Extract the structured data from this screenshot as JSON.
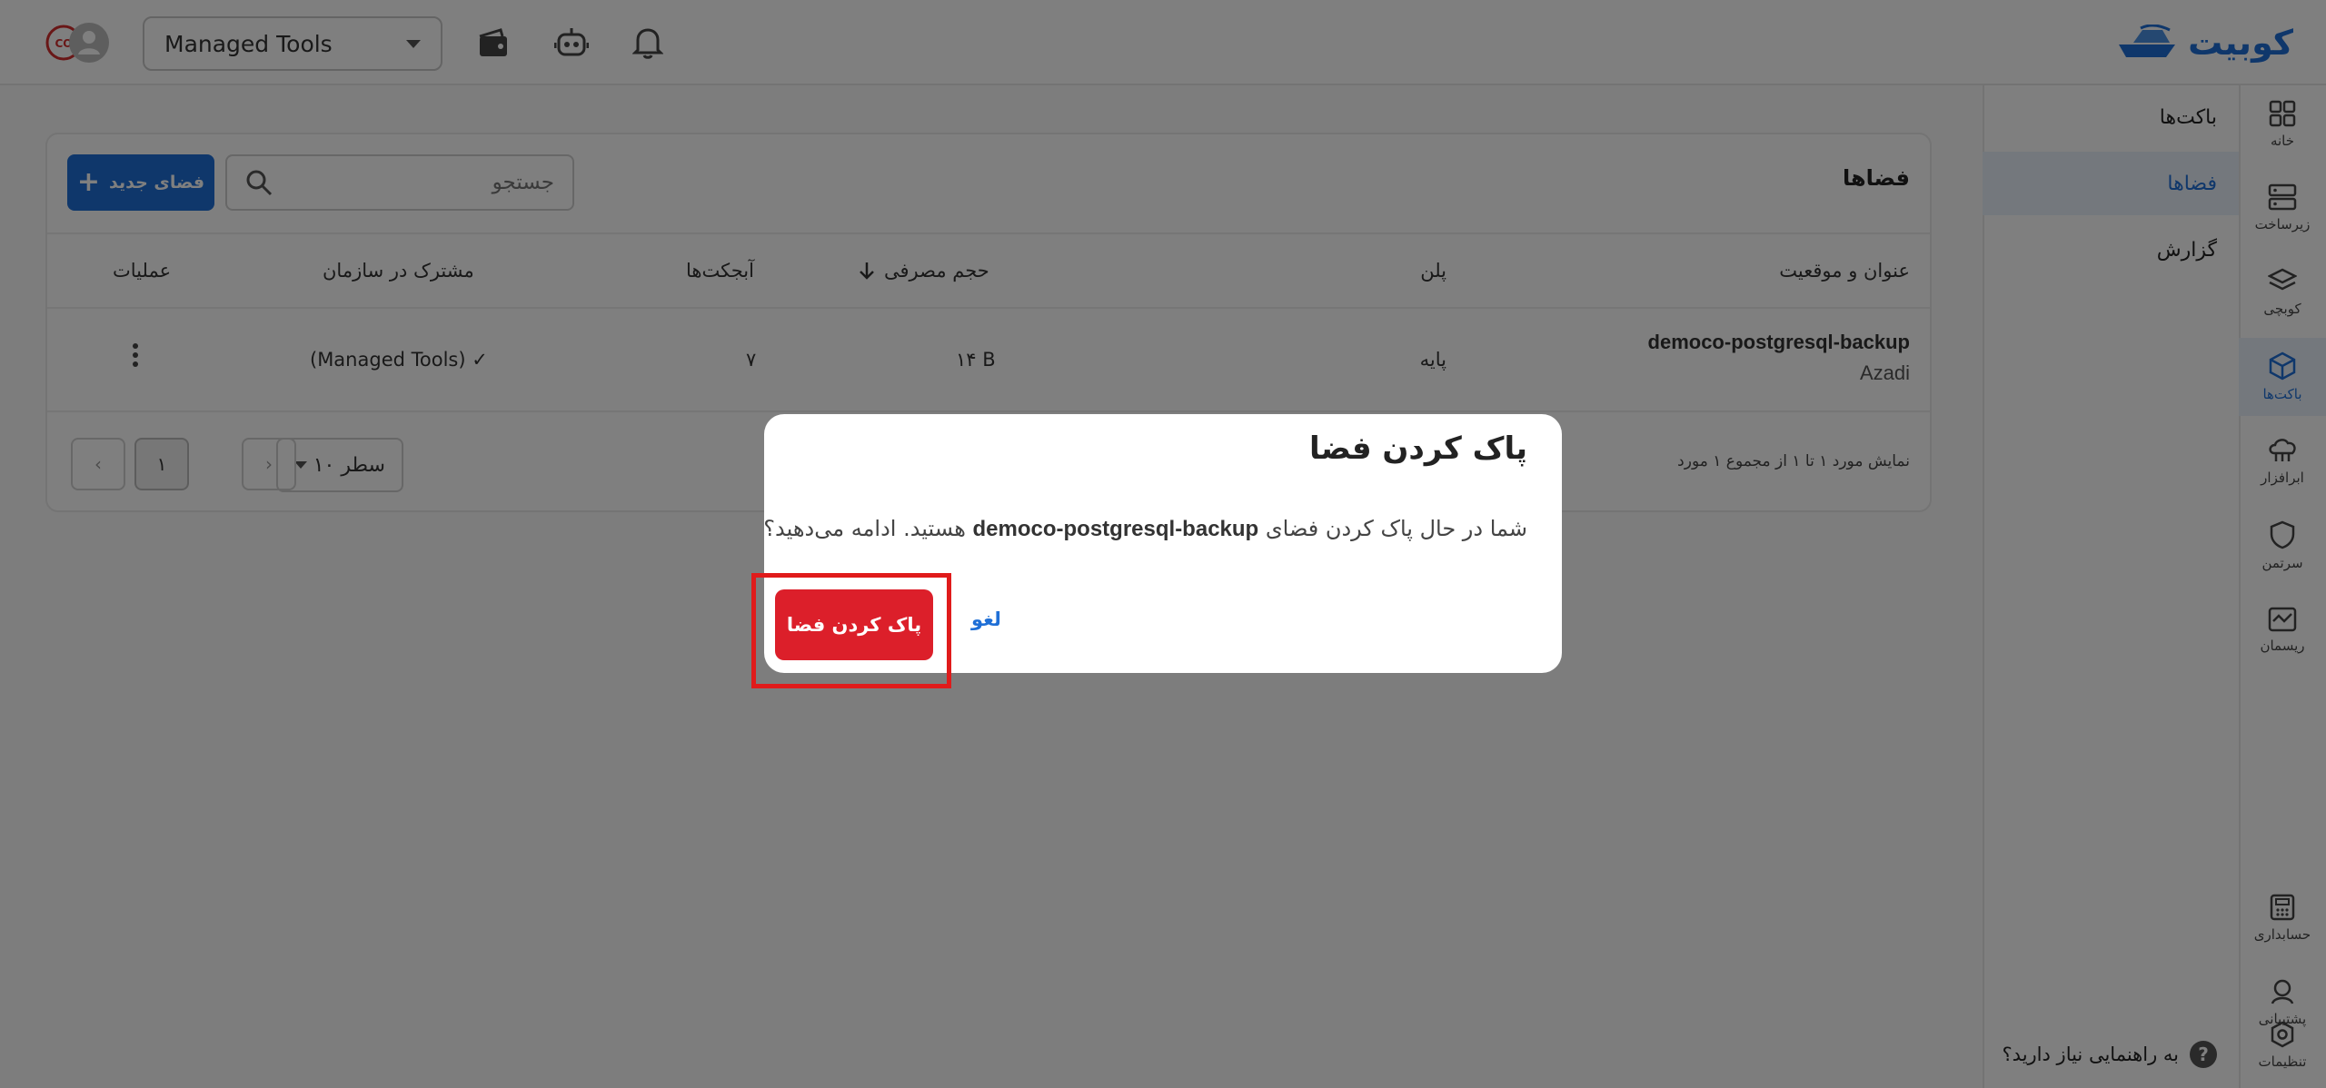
{
  "brand": {
    "name": "کوبیت",
    "color": "#1f6fd6"
  },
  "topbar": {
    "org_select_value": "Managed Tools",
    "icons": [
      "notification-bell-icon",
      "robot-icon",
      "wallet-icon",
      "user-avatar-icon"
    ]
  },
  "rail": {
    "items": [
      {
        "label": "خانه",
        "icon": "grid-icon"
      },
      {
        "label": "زیرساخت",
        "icon": "server-icon"
      },
      {
        "label": "کوبچی",
        "icon": "layers-icon"
      },
      {
        "label": "باکت‌ها",
        "icon": "cube-icon",
        "active": true
      },
      {
        "label": "ابرافزار",
        "icon": "cloud-app-icon"
      },
      {
        "label": "سرتمن",
        "icon": "shield-icon"
      },
      {
        "label": "ریسمان",
        "icon": "network-icon"
      }
    ],
    "bottom_items": [
      {
        "label": "حسابداری",
        "icon": "calculator-icon"
      },
      {
        "label": "پشتیبانی",
        "icon": "support-icon"
      },
      {
        "label": "تنظیمات",
        "icon": "settings-icon"
      }
    ]
  },
  "subnav": {
    "items": [
      {
        "label": "باکت‌ها"
      },
      {
        "label": "فضاها",
        "active": true
      },
      {
        "label": "گزارش"
      }
    ],
    "help_text": "به راهنمایی نیاز دارید؟"
  },
  "spaces": {
    "title": "فضاها",
    "new_button_label": "فضای جدید",
    "search_placeholder": "جستجو",
    "columns": {
      "title_location": "عنوان و موقعیت",
      "plan": "پلن",
      "usage": "حجم مصرفی",
      "objects": "آبجکت‌ها",
      "shared": "مشترک در سازمان",
      "actions": "عملیات"
    },
    "rows": [
      {
        "name": "democo-postgresql-backup",
        "location": "Azadi",
        "plan": "پایه",
        "usage": "۱۴ B",
        "objects": "۷",
        "shared": "(Managed Tools) ✓"
      }
    ],
    "pagination": {
      "info": "نمایش مورد ۱ تا ۱ از مجموع ۱ مورد",
      "rows_per_page": "۱۰ سطر",
      "current_page": "۱"
    }
  },
  "dialog": {
    "title": "پاک کردن فضا",
    "body_before": "شما در حال پاک کردن فضای",
    "body_space": "democo-postgresql-backup",
    "body_after": "هستید. ادامه می‌دهید؟",
    "cancel_label": "لغو",
    "confirm_label": "پاک کردن فضا",
    "confirm_color": "#dc1f2a"
  }
}
